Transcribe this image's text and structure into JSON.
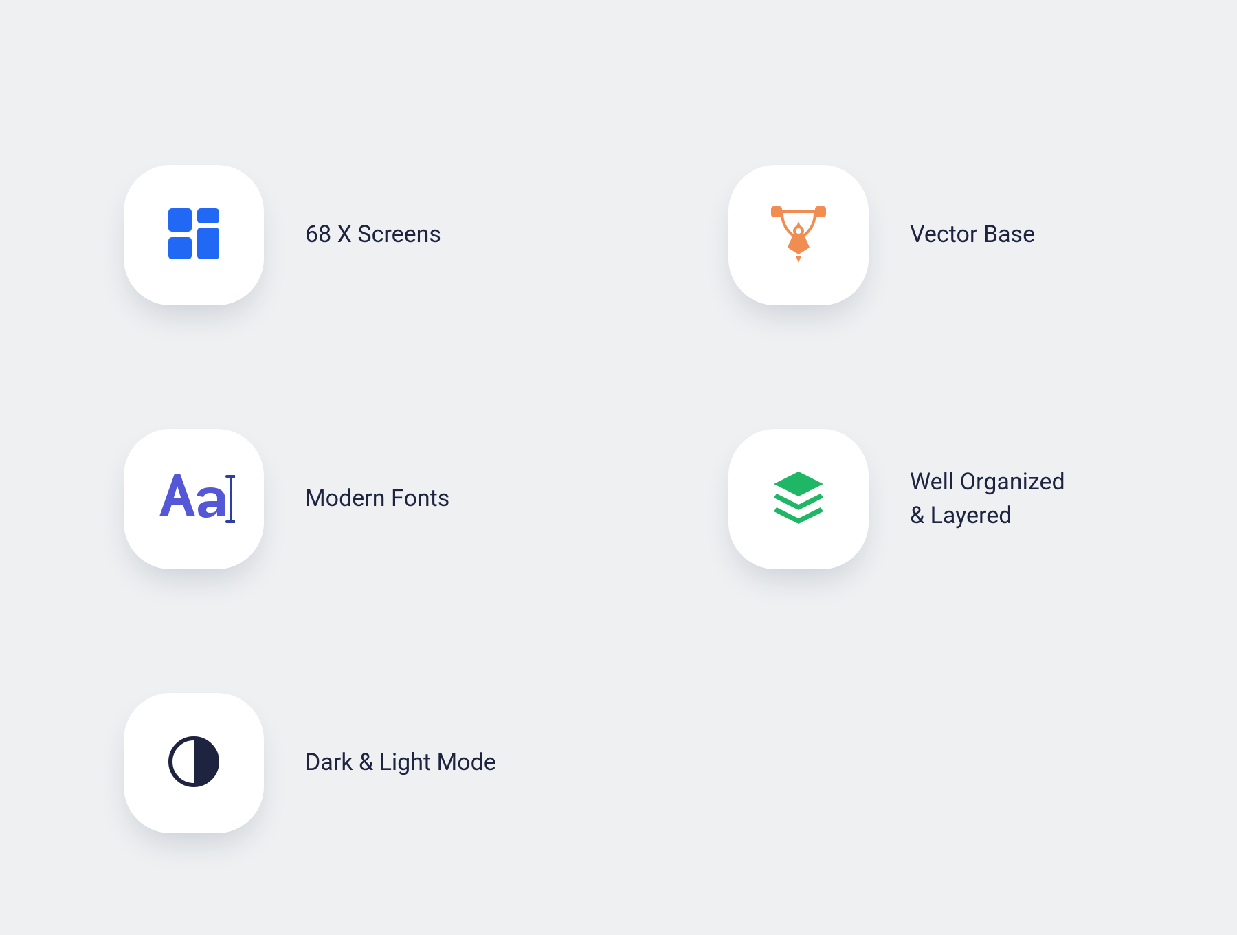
{
  "features": {
    "screens": {
      "label": "68 X Screens",
      "color": "#2169f5"
    },
    "vector": {
      "label": "Vector Base",
      "color": "#f28d52"
    },
    "fonts": {
      "label": "Modern Fonts",
      "color": "#5457d6",
      "color2": "#2d3ea4"
    },
    "layered": {
      "label": "Well Organized\n& Layered",
      "color": "#1fb766"
    },
    "darklight": {
      "label": "Dark & Light Mode",
      "color": "#1e2340"
    }
  }
}
